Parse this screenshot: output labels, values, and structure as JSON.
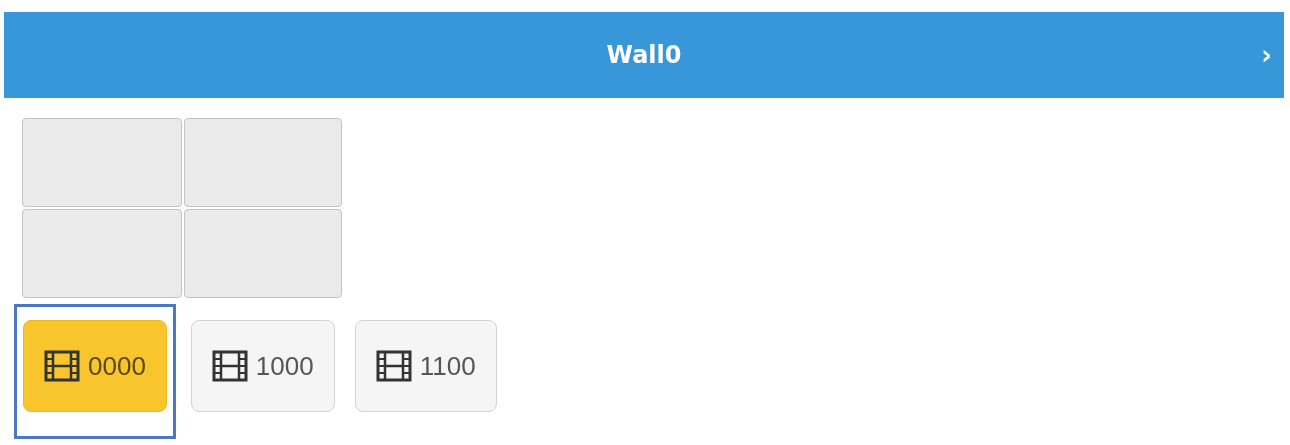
{
  "header": {
    "title": "Wall0",
    "next": "›"
  },
  "screens": [
    {
      "selected": false
    },
    {
      "selected": false
    },
    {
      "selected": false
    },
    {
      "selected": false
    }
  ],
  "channels": [
    {
      "label": "0000",
      "selected": true
    },
    {
      "label": "1000",
      "selected": false
    },
    {
      "label": "1100",
      "selected": false
    }
  ]
}
